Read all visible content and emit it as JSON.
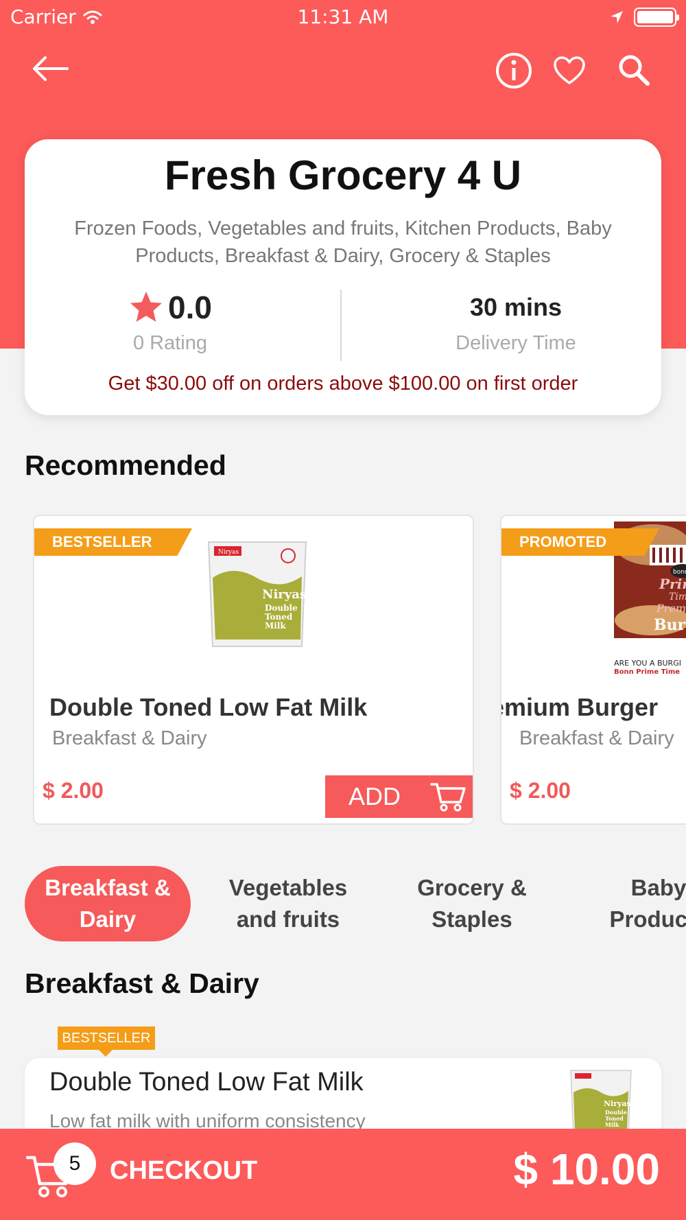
{
  "status_bar": {
    "carrier": "Carrier",
    "time": "11:31 AM"
  },
  "store": {
    "name": "Fresh Grocery 4 U",
    "categories": "Frozen Foods, Vegetables and fruits, Kitchen Products, Baby Products, Breakfast & Dairy, Grocery & Staples",
    "rating_value": "0.0",
    "rating_label": "0 Rating",
    "delivery_value": "30 mins",
    "delivery_label": "Delivery Time",
    "offer": "Get $30.00 off on orders above $100.00  on first order"
  },
  "recommended": {
    "title": "Recommended",
    "items": [
      {
        "badge": "BESTSELLER",
        "name": "Double Toned Low Fat Milk",
        "category": "Breakfast & Dairy",
        "price": "$ 2.00",
        "add_label": "ADD"
      },
      {
        "badge": "PROMOTED",
        "name": "Premium Burger",
        "category": "Breakfast & Dairy",
        "price": "$ 2.00"
      }
    ]
  },
  "milk_pack": {
    "brand": "Niryas",
    "line1": "Double",
    "line2": "Toned",
    "line3": "Milk"
  },
  "burger_pack": {
    "brand": "bonn",
    "script1": "Prime",
    "script2": "Time",
    "word1": "Premi",
    "word2": "Burge",
    "tag1": "ARE YOU A BURGI",
    "tag2": "Bonn Prime Time"
  },
  "category_tabs": [
    {
      "line1": "Breakfast &",
      "line2": "Dairy",
      "active": true
    },
    {
      "line1": "Vegetables",
      "line2": "and fruits",
      "active": false
    },
    {
      "line1": "Grocery &",
      "line2": "Staples",
      "active": false
    },
    {
      "line1": "Baby",
      "line2": "Products",
      "active": false
    }
  ],
  "section": {
    "title": "Breakfast & Dairy",
    "items": [
      {
        "badge": "BESTSELLER",
        "name": "Double Toned Low Fat Milk",
        "description": "Low fat milk with uniform consistency"
      }
    ]
  },
  "checkout": {
    "count": "5",
    "label": "CHECKOUT",
    "total": "$ 10.00"
  },
  "icons": [
    "back-arrow-icon",
    "info-icon",
    "heart-icon",
    "search-icon",
    "star-icon",
    "cart-icon",
    "wifi-icon",
    "location-arrow-icon",
    "battery-icon"
  ],
  "colors": {
    "brand": "#fd5a5a",
    "badge": "#f49d18",
    "offer_text": "#8b0b0b",
    "price": "#f05a5a"
  }
}
